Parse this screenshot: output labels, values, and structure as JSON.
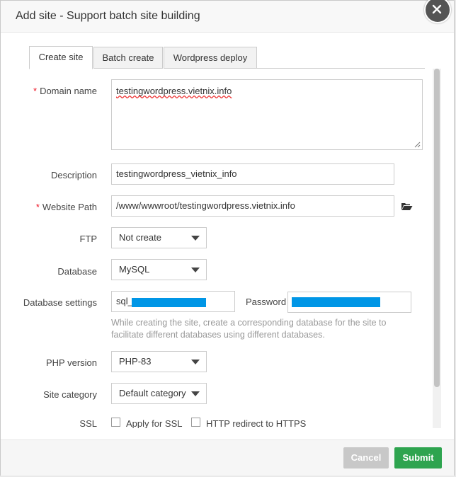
{
  "dialog": {
    "title": "Add site - Support batch site building"
  },
  "tabs": [
    {
      "label": "Create site",
      "active": true
    },
    {
      "label": "Batch create",
      "active": false
    },
    {
      "label": "Wordpress deploy",
      "active": false
    }
  ],
  "form": {
    "domain": {
      "label": "Domain name",
      "required_mark": "*",
      "value": "testingwordpress.vietnix.info"
    },
    "description": {
      "label": "Description",
      "value": "testingwordpress_vietnix_info"
    },
    "path": {
      "label": "Website Path",
      "required_mark": "*",
      "value": "/www/wwwroot/testingwordpress.vietnix.info"
    },
    "ftp": {
      "label": "FTP",
      "value": "Not create"
    },
    "database": {
      "label": "Database",
      "value": "MySQL"
    },
    "db_settings": {
      "label": "Database settings",
      "user_prefix": "sql_",
      "password_label": "Password",
      "help": "While creating the site, create a corresponding database for the site to facilitate different databases using different databases."
    },
    "php": {
      "label": "PHP version",
      "value": "PHP-83"
    },
    "category": {
      "label": "Site category",
      "value": "Default category"
    },
    "ssl": {
      "label": "SSL",
      "apply_label": "Apply for SSL",
      "redirect_label": "HTTP redirect to HTTPS"
    }
  },
  "footer": {
    "cancel_label": "Cancel",
    "submit_label": "Submit"
  },
  "colors": {
    "submit": "#2ea44f",
    "cancel": "#c8c8c8",
    "redaction": "#0096e6",
    "required": "#e11122"
  },
  "icons": [
    "close-icon",
    "folder-open-icon",
    "chevron-down-icon"
  ]
}
